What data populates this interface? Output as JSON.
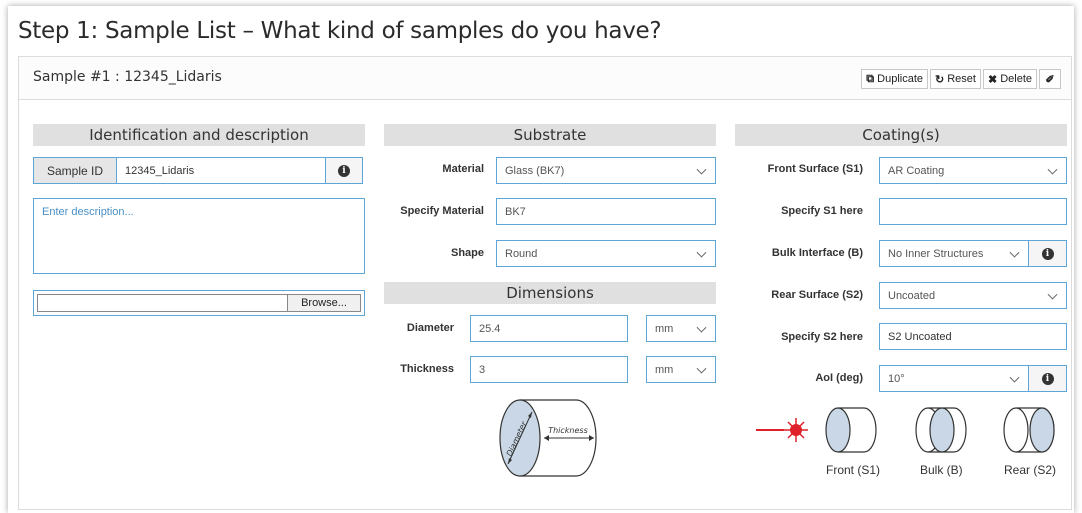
{
  "page": {
    "title": "Step 1: Sample List – What kind of samples do you have?"
  },
  "sample": {
    "header": "Sample #1 : 12345_Lidaris",
    "toolbar": {
      "duplicate": "Duplicate",
      "reset": "Reset",
      "delete": "Delete"
    }
  },
  "identification": {
    "heading": "Identification and description",
    "sample_id_label": "Sample ID",
    "sample_id_value": "12345_Lidaris",
    "description_placeholder": "Enter description...",
    "browse_label": "Browse..."
  },
  "substrate": {
    "heading": "Substrate",
    "material_label": "Material",
    "material_value": "Glass (BK7)",
    "specify_label": "Specify Material",
    "specify_value": "BK7",
    "shape_label": "Shape",
    "shape_value": "Round"
  },
  "dimensions": {
    "heading": "Dimensions",
    "diameter_label": "Diameter",
    "diameter_value": "25.4",
    "diameter_unit": "mm",
    "thickness_label": "Thickness",
    "thickness_value": "3",
    "thickness_unit": "mm",
    "diagram_diameter": "Diameter",
    "diagram_thickness": "Thickness"
  },
  "coatings": {
    "heading": "Coating(s)",
    "front_label": "Front Surface (S1)",
    "front_value": "AR Coating",
    "specify_s1_label": "Specify S1 here",
    "specify_s1_value": "",
    "bulk_label": "Bulk Interface (B)",
    "bulk_value": "No Inner Structures",
    "rear_label": "Rear Surface (S2)",
    "rear_value": "Uncoated",
    "specify_s2_label": "Specify S2 here",
    "specify_s2_value": "S2 Uncoated",
    "aoi_label": "AoI (deg)",
    "aoi_value": "10°",
    "diagram": {
      "front": "Front (S1)",
      "bulk": "Bulk (B)",
      "rear": "Rear (S2)"
    }
  },
  "colors": {
    "input_border": "#5ea6d8",
    "section_header": "#e0e0e0",
    "laser": "#e0202a"
  }
}
